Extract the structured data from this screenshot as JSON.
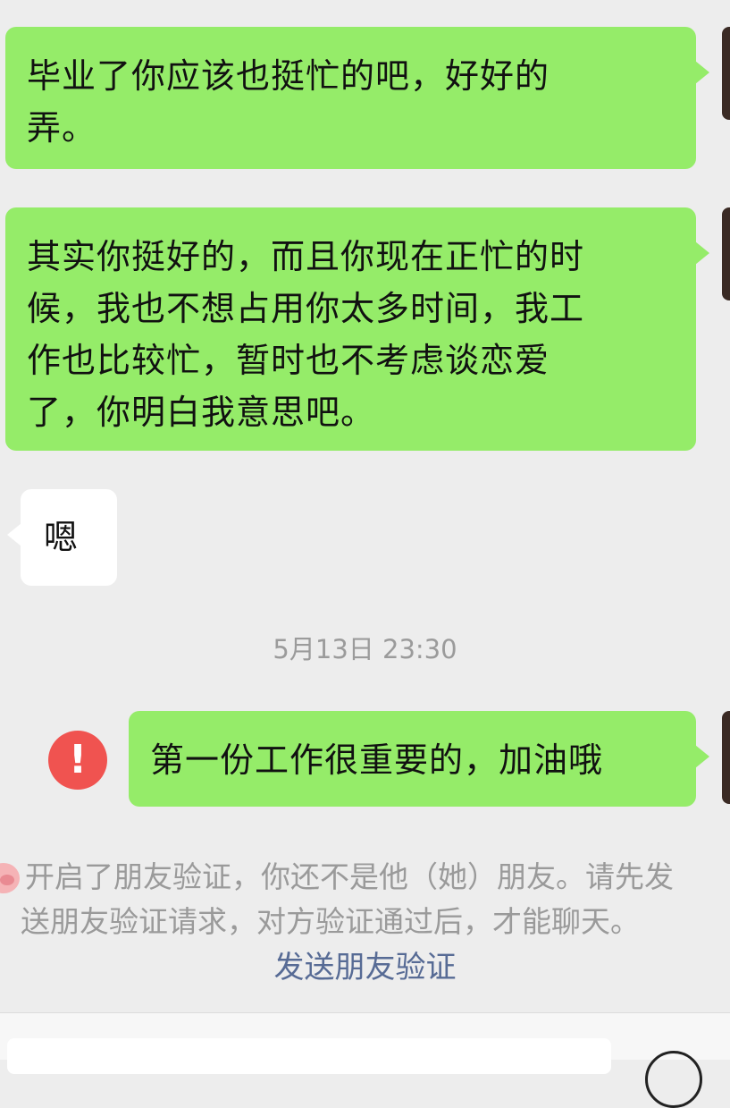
{
  "messages": [
    {
      "direction": "outgoing",
      "text": "毕业了你应该也挺忙的吧，好好的\n弄。"
    },
    {
      "direction": "outgoing",
      "text": "其实你挺好的，而且你现在正忙的时\n候，我也不想占用你太多时间，我工\n作也比较忙，暂时也不考虑谈恋爱\n了，你明白我意思吧。"
    },
    {
      "direction": "incoming",
      "text": "嗯"
    },
    {
      "direction": "outgoing",
      "text": "第一份工作很重要的，加油哦",
      "status": "failed"
    }
  ],
  "timestamp": "5月13日 23:30",
  "failed_icon_glyph": "!",
  "system_notice": {
    "line1": "开启了朋友验证，你还不是他（她）朋友。请先发",
    "line2": "送朋友验证请求，对方验证通过后，才能聊天。",
    "link_text": "发送朋友验证"
  },
  "icons": {
    "failed": "exclamation-circle-icon",
    "contact": "pig-icon",
    "voice": "voice-icon"
  },
  "colors": {
    "outgoing_bubble": "#95ec69",
    "incoming_bubble": "#ffffff",
    "background": "#ededed",
    "error": "#f05350",
    "link": "#576b95"
  }
}
